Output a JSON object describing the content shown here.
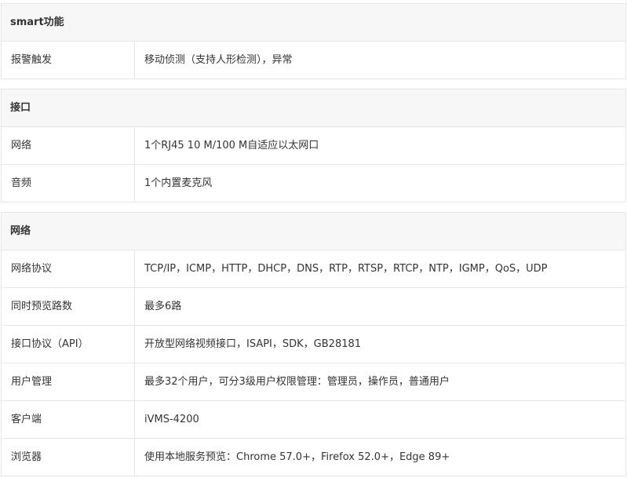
{
  "sections": [
    {
      "title": "smart功能",
      "rows": [
        {
          "label": "报警触发",
          "value": "移动侦测（支持人形检测），异常"
        }
      ]
    },
    {
      "title": "接口",
      "rows": [
        {
          "label": "网络",
          "value": "1个RJ45 10 M/100 M自适应以太网口"
        },
        {
          "label": "音频",
          "value": "1个内置麦克风"
        }
      ]
    },
    {
      "title": "网络",
      "rows": [
        {
          "label": "网络协议",
          "value": "TCP/IP，ICMP，HTTP，DHCP，DNS，RTP，RTSP，RTCP，NTP，IGMP，QoS，UDP"
        },
        {
          "label": "同时预览路数",
          "value": "最多6路"
        },
        {
          "label": "接口协议（API）",
          "value": "开放型网络视频接口，ISAPI，SDK，GB28181"
        },
        {
          "label": "用户管理",
          "value": "最多32个用户，可分3级用户权限管理：管理员，操作员，普通用户"
        },
        {
          "label": "客户端",
          "value": "iVMS-4200"
        },
        {
          "label": "浏览器",
          "value": "使用本地服务预览：Chrome 57.0+，Firefox 52.0+，Edge 89+"
        }
      ]
    }
  ]
}
